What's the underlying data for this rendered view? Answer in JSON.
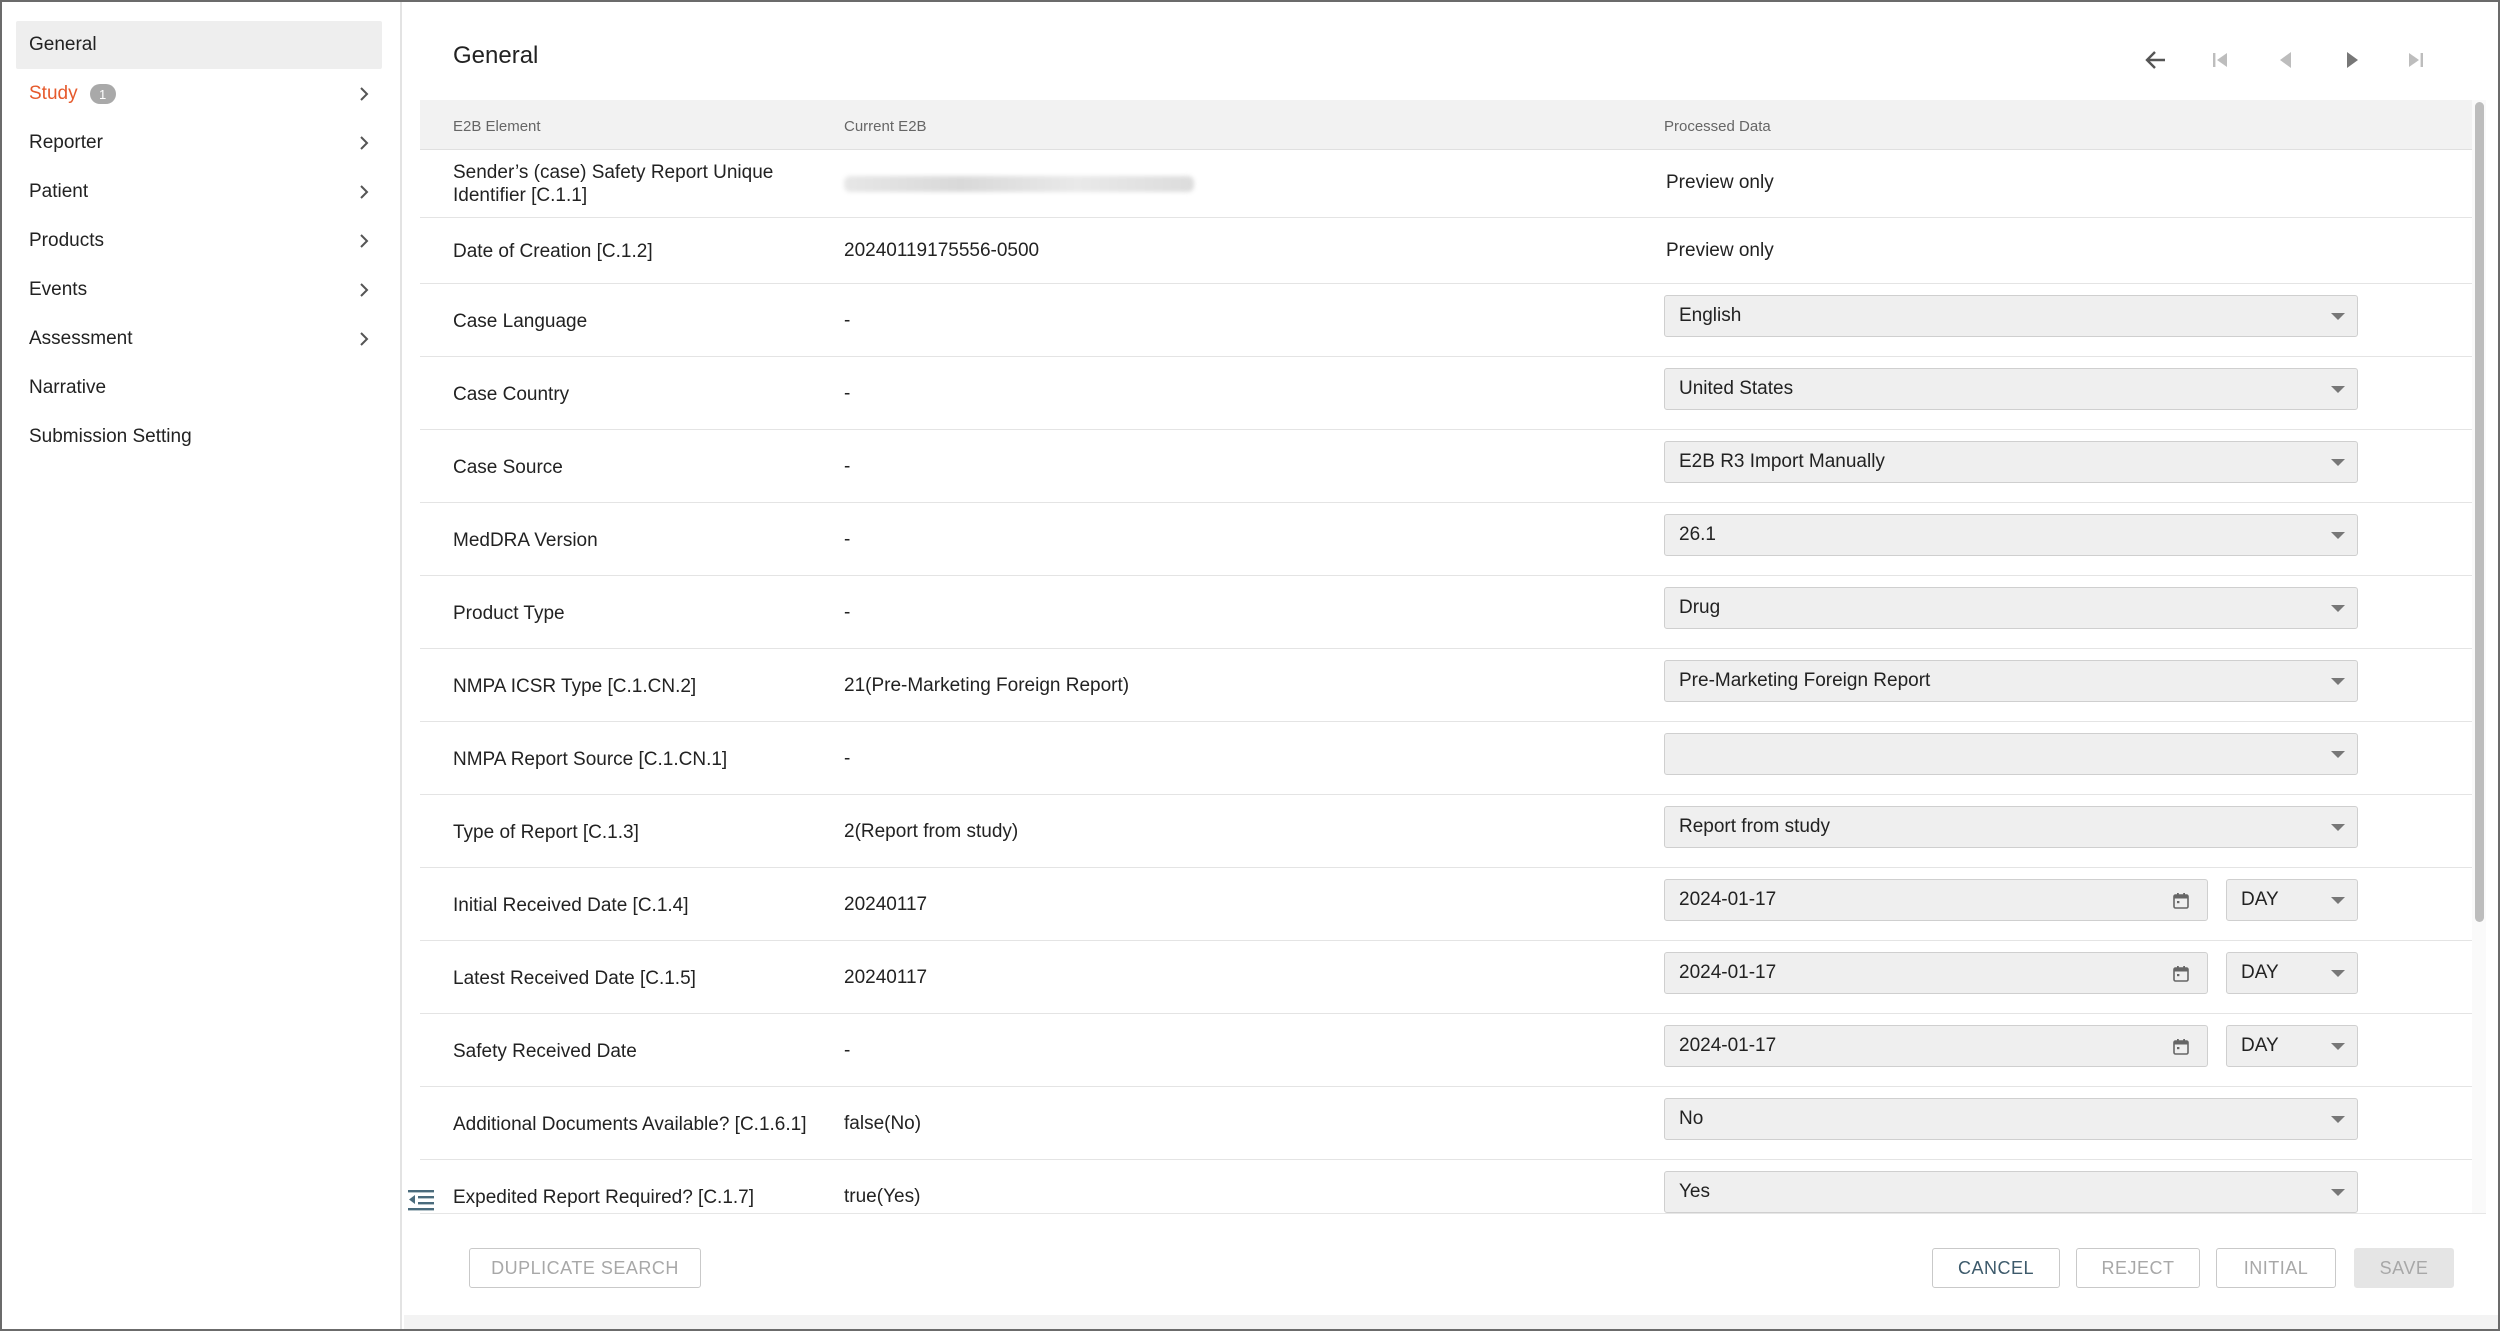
{
  "sidebar": {
    "items": [
      {
        "label": "General",
        "active": true,
        "chevron": false
      },
      {
        "label": "Study",
        "badge": "1",
        "chevron": true,
        "color": "#e65a2c"
      },
      {
        "label": "Reporter",
        "chevron": true
      },
      {
        "label": "Patient",
        "chevron": true
      },
      {
        "label": "Products",
        "chevron": true
      },
      {
        "label": "Events",
        "chevron": true
      },
      {
        "label": "Assessment",
        "chevron": true
      },
      {
        "label": "Narrative",
        "chevron": false
      },
      {
        "label": "Submission Setting",
        "chevron": false
      }
    ]
  },
  "main": {
    "title": "General",
    "nav_icons": [
      "back-arrow-icon",
      "first-page-icon",
      "previous-icon",
      "next-icon",
      "last-page-icon"
    ],
    "columns": {
      "element": "E2B Element",
      "current": "Current E2B",
      "processed": "Processed Data"
    },
    "rows": [
      {
        "label": "Sender’s (case) Safety Report Unique Identifier [C.1.1]",
        "current_blurred": true,
        "processed_text": "Preview only"
      },
      {
        "label": "Date of Creation [C.1.2]",
        "current": "20240119175556-0500",
        "processed_text": "Preview only"
      },
      {
        "label": "Case Language",
        "current": "-",
        "select": "English"
      },
      {
        "label": "Case Country",
        "current": "-",
        "select": "United States"
      },
      {
        "label": "Case Source",
        "current": "-",
        "select": "E2B R3 Import Manually"
      },
      {
        "label": "MedDRA Version",
        "current": "-",
        "select": "26.1"
      },
      {
        "label": "Product Type",
        "current": "-",
        "select": "Drug"
      },
      {
        "label": "NMPA ICSR Type [C.1.CN.2]",
        "current": "21(Pre-Marketing Foreign Report)",
        "select": "Pre-Marketing Foreign Report"
      },
      {
        "label": "NMPA Report Source [C.1.CN.1]",
        "current": "-",
        "select": ""
      },
      {
        "label": "Type of Report [C.1.3]",
        "current": "2(Report from study)",
        "select": "Report from study"
      },
      {
        "label": "Initial Received Date [C.1.4]",
        "current": "20240117",
        "date": "2024-01-17",
        "precision": "DAY"
      },
      {
        "label": "Latest Received Date [C.1.5]",
        "current": "20240117",
        "date": "2024-01-17",
        "precision": "DAY"
      },
      {
        "label": "Safety Received Date",
        "current": "-",
        "date": "2024-01-17",
        "precision": "DAY"
      },
      {
        "label": "Additional Documents Available? [C.1.6.1]",
        "current": "false(No)",
        "select": "No"
      },
      {
        "label": "Expedited Report Required? [C.1.7]",
        "current": "true(Yes)",
        "select": "Yes"
      }
    ]
  },
  "footer": {
    "duplicate_search": "DUPLICATE SEARCH",
    "cancel": "CANCEL",
    "reject": "REJECT",
    "initial": "INITIAL",
    "save": "SAVE"
  },
  "colors": {
    "accent_orange": "#e65a2c",
    "cancel_text": "#3d5a6b",
    "field_bg": "#efefef",
    "header_bg": "#f2f2f2"
  }
}
